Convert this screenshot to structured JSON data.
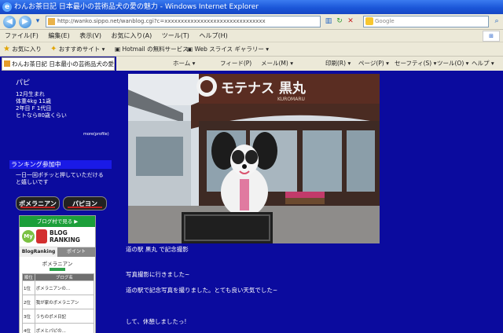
{
  "window": {
    "title": "わんお茶日記 日本最小の芸術品犬の愛の魅力 - Windows Internet Explorer"
  },
  "address": {
    "url": "http://wanko.sippo.net/wanblog.cgi?c=xxxxxxxxxxxxxxxxxxxxxxxxxxxxxxx",
    "search_placeholder": "Google"
  },
  "menu": {
    "items": [
      "ファイル(F)",
      "編集(E)",
      "表示(V)",
      "お気に入り(A)",
      "ツール(T)",
      "ヘルプ(H)"
    ]
  },
  "favorites": {
    "label": "お気に入り",
    "item1": "おすすめサイト ▾",
    "item2": "Hotmail の無料サービス",
    "item3": "Web スライス ギャラリー ▾"
  },
  "tab": {
    "label": "わんお茶日記 日本最小の芸術品犬の愛の魅力"
  },
  "toolbar": {
    "home": "ホーム ▾",
    "feeds": "フィード(P)",
    "mail": "メール(M) ▾",
    "print": "印刷(R) ▾",
    "page": "ページ(P) ▾",
    "safety": "セーフティ(S) ▾",
    "tools": "ツール(O) ▾",
    "help": "ヘルプ ▾"
  },
  "sidebar": {
    "profile_name": "パピ",
    "profile_lines": [
      "12月生まれ",
      "体重4kg 11歳",
      "2年目 F 1代目",
      "ヒトなら80歳くらい"
    ],
    "more_link": "more(profile)",
    "ranking_title": "ランキング参加中",
    "ranking_desc": "一日一回ポチッと押していただけると嬉しいです",
    "tag1": "ポメラニアン",
    "tag2": "パピヨン"
  },
  "widget": {
    "header": "ブログ村で見る ▶",
    "logo_line1": "BLOG",
    "logo_line2": "RANKING",
    "tab1": "BlogRanking",
    "tab2": "ポイント",
    "category": "ポメラニアン",
    "col1": "順位",
    "col2": "ブログ名",
    "rows": [
      {
        "rank": "1位",
        "name": "ポメラニアンの..."
      },
      {
        "rank": "2位",
        "name": "我が家のポメラニアン"
      },
      {
        "rank": "3位",
        "name": "うちのポメ日記"
      },
      {
        "rank": "4位",
        "name": "ポメとパピの..."
      }
    ]
  },
  "photo": {
    "sign": "モテナス 黒丸",
    "sign_sub": "KUROMARU"
  },
  "post": {
    "caption": "道の駅 黒丸 で記念撮影",
    "line1": "写真撮影に行きました~",
    "line2": "道の駅で記念写真を撮りました。とても良い天気でした~",
    "line3": "して、休憩しましたっ!"
  }
}
